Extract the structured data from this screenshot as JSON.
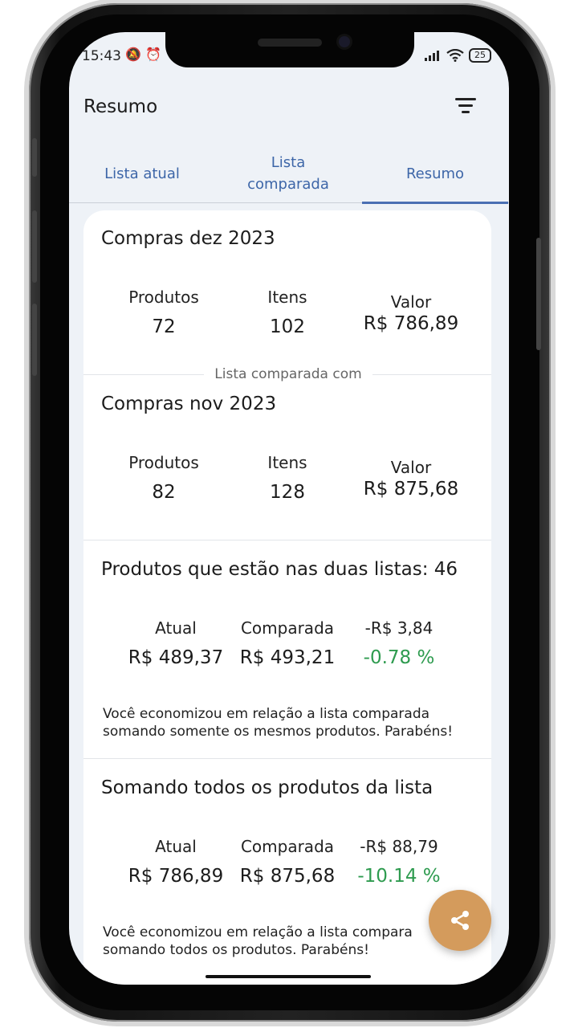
{
  "status": {
    "time": "15:43",
    "battery": "25"
  },
  "app_bar": {
    "title": "Resumo"
  },
  "tabs": [
    {
      "label": "Lista atual"
    },
    {
      "label": "Lista comparada"
    },
    {
      "label": "Resumo",
      "active": true
    }
  ],
  "current": {
    "title": "Compras dez 2023",
    "products_label": "Produtos",
    "products": "72",
    "items_label": "Itens",
    "items": "102",
    "value_label": "Valor",
    "value": "R$ 786,89"
  },
  "divider_label": "Lista comparada com",
  "compared": {
    "title": "Compras nov 2023",
    "products_label": "Produtos",
    "products": "82",
    "items_label": "Itens",
    "items": "128",
    "value_label": "Valor",
    "value": "R$ 875,68"
  },
  "common": {
    "title": "Produtos que estão nas duas listas: 46",
    "current_label": "Atual",
    "current_value": "R$ 489,37",
    "compared_label": "Comparada",
    "compared_value": "R$ 493,21",
    "diff_value": "-R$ 3,84",
    "diff_percent": "-0.78 %",
    "note_line1": "Você economizou em relação a lista comparada",
    "note_line2": "somando somente os mesmos produtos. Parabéns!"
  },
  "all": {
    "title": "Somando todos os produtos da lista",
    "current_label": "Atual",
    "current_value": "R$ 786,89",
    "compared_label": "Comparada",
    "compared_value": "R$ 875,68",
    "diff_value": "-R$ 88,79",
    "diff_percent": "-10.14 %",
    "note_line1": "Você economizou em relação a lista compara",
    "note_line2": "somando todos os produtos. Parabéns!"
  },
  "colors": {
    "accent": "#4a6fb3",
    "positive": "#2e9b4f",
    "fab": "#d49b5c"
  },
  "icons": {
    "filter": "filter-lines-icon",
    "share": "share-icon"
  }
}
